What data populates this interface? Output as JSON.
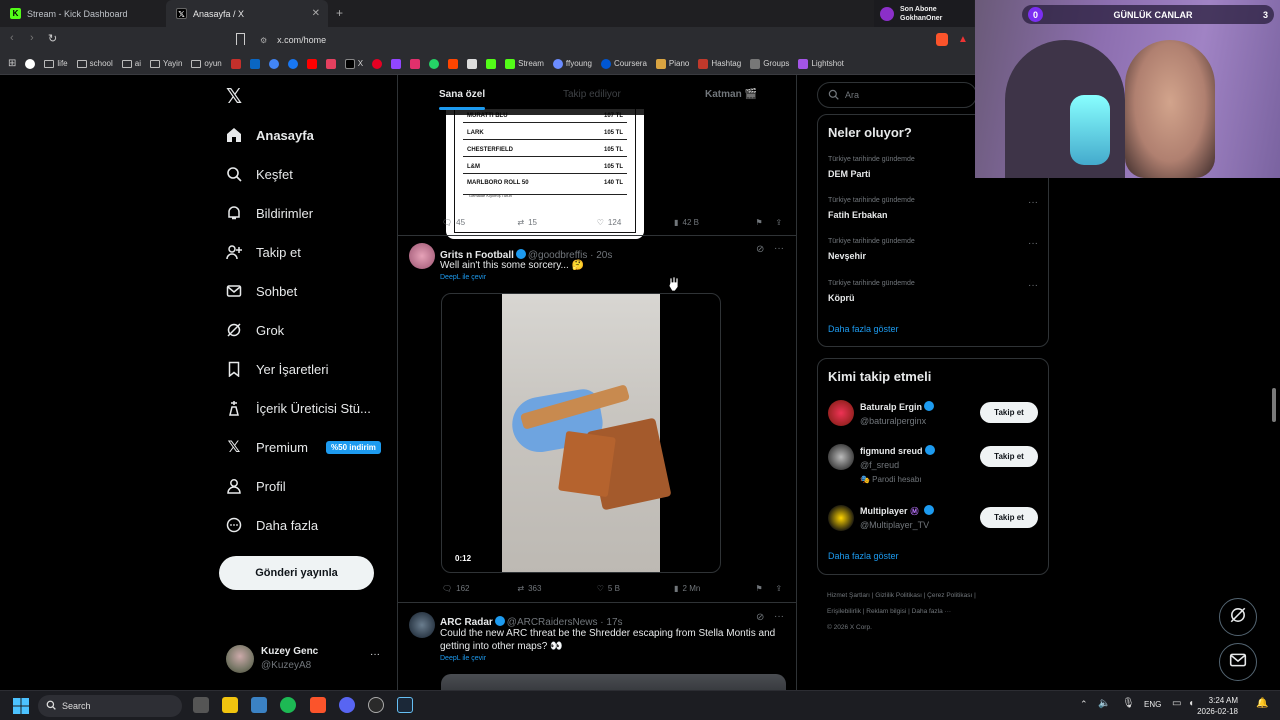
{
  "browser": {
    "tabs": [
      {
        "label": "Stream - Kick Dashboard",
        "icon": "kick-icon"
      },
      {
        "label": "Anasayfa / X",
        "icon": "x-logo-icon"
      }
    ],
    "new_tab": "+",
    "url": "x.com/home",
    "bookmarks": [
      "life",
      "school",
      "ai",
      "Yayin",
      "oyun",
      "X",
      "Stream",
      "ffyoung",
      "Coursera",
      "Piano",
      "Hashtag",
      "Groups",
      "Lightshot"
    ]
  },
  "overlay": {
    "subscriber_label": "Son Abone",
    "subscriber_name": "GokhanOner",
    "counter_left": "0",
    "counter_title": "GÜNLÜK CANLAR",
    "counter_right": "3"
  },
  "nav": {
    "items": [
      {
        "label": "Anasayfa",
        "icon": "home-icon"
      },
      {
        "label": "Keşfet",
        "icon": "search-icon"
      },
      {
        "label": "Bildirimler",
        "icon": "bell-icon"
      },
      {
        "label": "Takip et",
        "icon": "add-user-icon"
      },
      {
        "label": "Sohbet",
        "icon": "mail-icon"
      },
      {
        "label": "Grok",
        "icon": "grok-icon"
      },
      {
        "label": "Yer İşaretleri",
        "icon": "bookmark-icon"
      },
      {
        "label": "İçerik Üreticisi Stü...",
        "icon": "creator-icon"
      },
      {
        "label": "Premium",
        "icon": "x-logo-icon"
      },
      {
        "label": "Profil",
        "icon": "profile-icon"
      },
      {
        "label": "Daha fazla",
        "icon": "more-circle-icon"
      }
    ],
    "premium_badge": "%50 indirim",
    "post_button": "Gönderi yayınla",
    "account_name": "Kuzey Genc",
    "account_handle": "@KuzeyA8",
    "account_more": "···"
  },
  "feed": {
    "tabs": [
      "Sana özel",
      "Takip ediliyor",
      "Katman 🎬"
    ],
    "price_list": [
      {
        "name": "MURATTI BLU",
        "price": "107 TL"
      },
      {
        "name": "LARK",
        "price": "105 TL"
      },
      {
        "name": "CHESTERFIELD",
        "price": "105 TL"
      },
      {
        "name": "L&M",
        "price": "105 TL"
      },
      {
        "name": "MARLBORO ROLL 50",
        "price": "140 TL"
      }
    ],
    "price_list_note": "Gemalde Kıyılmış Tütün",
    "tweets": [
      {
        "replies": "45",
        "reposts": "15",
        "likes": "124",
        "views": "42 B"
      },
      {
        "name": "Grits n Football",
        "handle": "@goodbreffis · 20s",
        "text": "Well ain't this some sorcery... 🤔",
        "translate": "DeepL ile çevir",
        "video_time": "0:12",
        "replies": "162",
        "reposts": "363",
        "likes": "5 B",
        "views": "2 Mn"
      },
      {
        "name": "ARC Radar",
        "handle": "@ARCRaidersNews · 17s",
        "text": "Could the new ARC threat be the Shredder escaping from Stella Montis and getting into other maps? 👀",
        "translate": "DeepL ile çevir"
      }
    ]
  },
  "sidebar": {
    "search_placeholder": "Ara",
    "trends_title": "Neler oluyor?",
    "trends": [
      {
        "meta": "Türkiye tarihinde gündemde",
        "name": "DEM Parti"
      },
      {
        "meta": "Türkiye tarihinde gündemde",
        "name": "Fatih Erbakan"
      },
      {
        "meta": "Türkiye tarihinde gündemde",
        "name": "Nevşehir"
      },
      {
        "meta": "Türkiye tarihinde gündemde",
        "name": "Köprü"
      }
    ],
    "show_more": "Daha fazla göster",
    "who_title": "Kimi takip etmeli",
    "who": [
      {
        "name": "Baturalp Ergin",
        "handle": "@baturalperginx",
        "extra": ""
      },
      {
        "name": "figmund sreud",
        "handle": "@f_sreud",
        "extra": "🎭 Parodi hesabı"
      },
      {
        "name": "Multiplayer",
        "handle": "@Multiplayer_TV",
        "extra": ""
      }
    ],
    "follow_label": "Takip et",
    "footer_line1": "Hizmet Şartları  |  Gizlilik Politikası  |  Çerez Politikası  |",
    "footer_line2": "Erişilebilirlik  |  Reklam bilgisi  |  Daha fazla ···",
    "footer_line3": "© 2026 X Corp."
  },
  "taskbar": {
    "search": "Search",
    "lang": "ENG",
    "time": "3:24 AM",
    "date": "2026-02-18"
  },
  "colors": {
    "accent": "#1d9bf0",
    "bg": "#000000",
    "border": "#2f3336",
    "muted": "#71767b"
  }
}
